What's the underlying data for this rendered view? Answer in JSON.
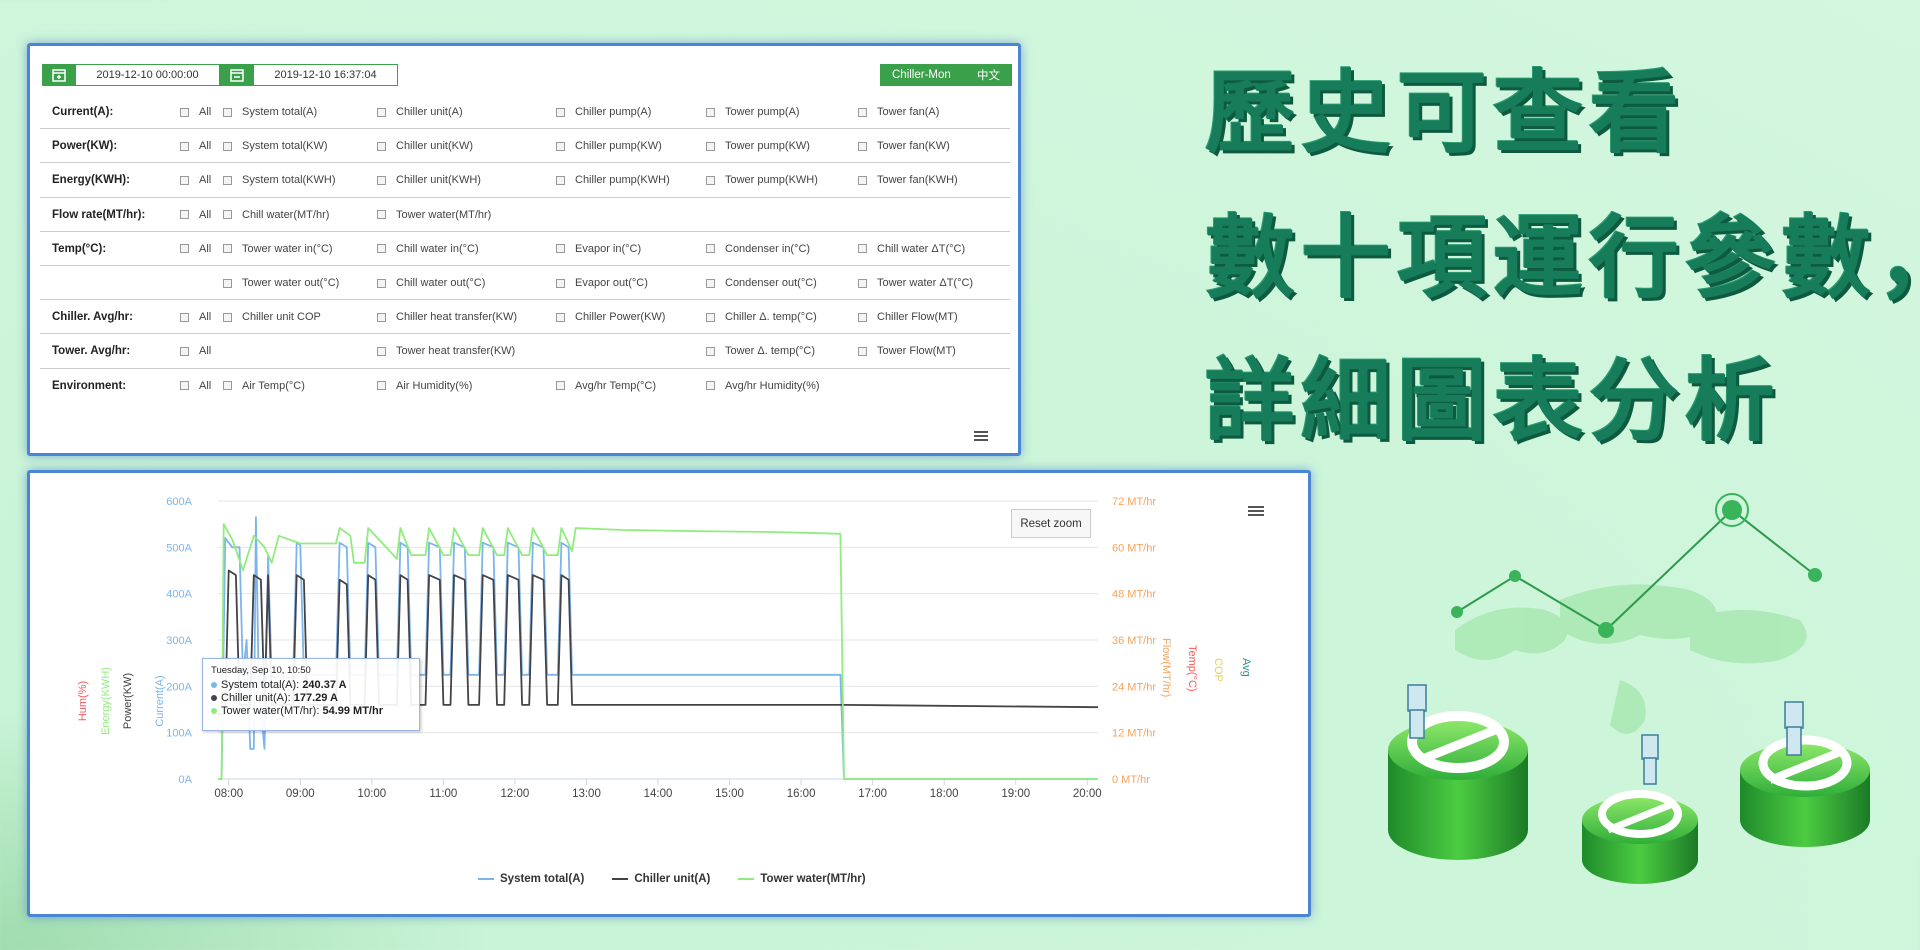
{
  "headline": {
    "line1": "歷史可查看",
    "line2": "數十項運行參數，",
    "line3": "詳細圖表分析"
  },
  "filters": {
    "start_date": "2019-12-10 00:00:00",
    "end_date": "2019-12-10 16:37:04",
    "app_name": "Chiller-Mon",
    "language": "中文",
    "rows": [
      {
        "label": "Current(A):",
        "options": [
          "All",
          "System total(A)",
          "Chiller unit(A)",
          "Chiller pump(A)",
          "Tower pump(A)",
          "Tower fan(A)"
        ]
      },
      {
        "label": "Power(KW):",
        "options": [
          "All",
          "System total(KW)",
          "Chiller unit(KW)",
          "Chiller pump(KW)",
          "Tower pump(KW)",
          "Tower fan(KW)"
        ]
      },
      {
        "label": "Energy(KWH):",
        "options": [
          "All",
          "System total(KWH)",
          "Chiller unit(KWH)",
          "Chiller pump(KWH)",
          "Tower pump(KWH)",
          "Tower fan(KWH)"
        ]
      },
      {
        "label": "Flow rate(MT/hr):",
        "options": [
          "All",
          "Chill water(MT/hr)",
          "Tower water(MT/hr)",
          "",
          "",
          ""
        ]
      },
      {
        "label": "Temp(°C):",
        "options": [
          "All",
          "Tower water in(°C)",
          "Chill water in(°C)",
          "Evapor in(°C)",
          "Condenser in(°C)",
          "Chill water ΔT(°C)"
        ]
      },
      {
        "label": "",
        "options": [
          "",
          "Tower water out(°C)",
          "Chill water out(°C)",
          "Evapor out(°C)",
          "Condenser out(°C)",
          "Tower water ΔT(°C)"
        ]
      },
      {
        "label": "Chiller. Avg/hr:",
        "options": [
          "All",
          "Chiller unit COP",
          "Chiller heat transfer(KW)",
          "Chiller Power(KW)",
          "Chiller Δ. temp(°C)",
          "Chiller Flow(MT)"
        ]
      },
      {
        "label": "Tower. Avg/hr:",
        "options": [
          "All",
          "",
          "Tower heat transfer(KW)",
          "",
          "Tower Δ. temp(°C)",
          "Tower Flow(MT)"
        ]
      },
      {
        "label": "Environment:",
        "options": [
          "All",
          "Air Temp(°C)",
          "Air Humidity(%)",
          "Avg/hr Temp(°C)",
          "Avg/hr Humidity(%)",
          ""
        ]
      }
    ]
  },
  "chart": {
    "reset_zoom_label": "Reset zoom",
    "left_axis_titles": [
      "Hum(%)",
      "Energy(KWH)",
      "Power(KW)",
      "Current(A)"
    ],
    "right_axis_titles": [
      "Flow(MT/hr)",
      "Temp(°C)",
      "COP",
      "Avg"
    ],
    "tooltip": {
      "header": "Tuesday, Sep 10, 10:50",
      "lines": [
        {
          "name": "System total(A):",
          "value": "240.37 A",
          "color": "#7cb5ec"
        },
        {
          "name": "Chiller unit(A):",
          "value": "177.29 A",
          "color": "#434348"
        },
        {
          "name": "Tower water(MT/hr):",
          "value": "54.99 MT/hr",
          "color": "#90ed7d"
        }
      ]
    }
  },
  "chart_data": {
    "type": "line",
    "x_ticks": [
      "08:00",
      "09:00",
      "10:00",
      "11:00",
      "12:00",
      "13:00",
      "14:00",
      "15:00",
      "16:00",
      "17:00",
      "18:00",
      "19:00",
      "20:00"
    ],
    "y_left_ticks": [
      "0A",
      "100A",
      "200A",
      "300A",
      "400A",
      "500A",
      "600A"
    ],
    "y_right_ticks": [
      "0 MT/hr",
      "12 MT/hr",
      "24 MT/hr",
      "36 MT/hr",
      "48 MT/hr",
      "60 MT/hr",
      "72 MT/hr"
    ],
    "ylim_left": [
      0,
      600
    ],
    "ylim_right": [
      0,
      72
    ],
    "xlim_hours": [
      7.85,
      20.15
    ],
    "series": [
      {
        "name": "System total(A)",
        "color": "#7cb5ec",
        "axis": "left",
        "points": [
          [
            7.85,
            0
          ],
          [
            7.9,
            0
          ],
          [
            7.95,
            520
          ],
          [
            8.05,
            500
          ],
          [
            8.15,
            500
          ],
          [
            8.2,
            220
          ],
          [
            8.25,
            300
          ],
          [
            8.3,
            65
          ],
          [
            8.35,
            65
          ],
          [
            8.38,
            565
          ],
          [
            8.42,
            200
          ],
          [
            8.5,
            65
          ],
          [
            8.55,
            480
          ],
          [
            8.6,
            220
          ],
          [
            8.9,
            220
          ],
          [
            8.95,
            510
          ],
          [
            9.0,
            505
          ],
          [
            9.05,
            225
          ],
          [
            9.5,
            225
          ],
          [
            9.55,
            510
          ],
          [
            9.65,
            500
          ],
          [
            9.7,
            225
          ],
          [
            9.9,
            225
          ],
          [
            9.95,
            510
          ],
          [
            10.05,
            500
          ],
          [
            10.1,
            225
          ],
          [
            10.35,
            225
          ],
          [
            10.4,
            510
          ],
          [
            10.5,
            500
          ],
          [
            10.55,
            225
          ],
          [
            10.75,
            225
          ],
          [
            10.8,
            510
          ],
          [
            10.95,
            500
          ],
          [
            11.0,
            225
          ],
          [
            11.1,
            225
          ],
          [
            11.15,
            510
          ],
          [
            11.3,
            500
          ],
          [
            11.35,
            225
          ],
          [
            11.5,
            225
          ],
          [
            11.55,
            510
          ],
          [
            11.7,
            500
          ],
          [
            11.75,
            225
          ],
          [
            11.85,
            225
          ],
          [
            11.9,
            510
          ],
          [
            12.05,
            500
          ],
          [
            12.1,
            225
          ],
          [
            12.2,
            225
          ],
          [
            12.25,
            510
          ],
          [
            12.4,
            500
          ],
          [
            12.45,
            225
          ],
          [
            12.6,
            225
          ],
          [
            12.65,
            510
          ],
          [
            12.75,
            500
          ],
          [
            12.8,
            225
          ],
          [
            16.55,
            225
          ],
          [
            16.6,
            0
          ],
          [
            20.15,
            0
          ]
        ]
      },
      {
        "name": "Chiller unit(A)",
        "color": "#434348",
        "axis": "left",
        "points": [
          [
            7.85,
            140
          ],
          [
            7.95,
            140
          ],
          [
            8.0,
            450
          ],
          [
            8.1,
            440
          ],
          [
            8.15,
            160
          ],
          [
            8.3,
            160
          ],
          [
            8.35,
            440
          ],
          [
            8.45,
            430
          ],
          [
            8.5,
            160
          ],
          [
            8.55,
            440
          ],
          [
            8.6,
            160
          ],
          [
            8.9,
            160
          ],
          [
            8.95,
            440
          ],
          [
            9.05,
            430
          ],
          [
            9.1,
            160
          ],
          [
            9.5,
            160
          ],
          [
            9.55,
            430
          ],
          [
            9.65,
            420
          ],
          [
            9.7,
            160
          ],
          [
            9.9,
            160
          ],
          [
            9.95,
            440
          ],
          [
            10.05,
            430
          ],
          [
            10.1,
            160
          ],
          [
            10.35,
            160
          ],
          [
            10.4,
            440
          ],
          [
            10.5,
            430
          ],
          [
            10.55,
            160
          ],
          [
            10.75,
            160
          ],
          [
            10.8,
            440
          ],
          [
            10.95,
            430
          ],
          [
            11.0,
            160
          ],
          [
            11.1,
            160
          ],
          [
            11.15,
            440
          ],
          [
            11.3,
            430
          ],
          [
            11.35,
            160
          ],
          [
            11.5,
            160
          ],
          [
            11.55,
            440
          ],
          [
            11.7,
            430
          ],
          [
            11.75,
            160
          ],
          [
            11.85,
            160
          ],
          [
            11.9,
            440
          ],
          [
            12.05,
            430
          ],
          [
            12.1,
            160
          ],
          [
            12.2,
            160
          ],
          [
            12.25,
            440
          ],
          [
            12.4,
            430
          ],
          [
            12.45,
            160
          ],
          [
            12.6,
            160
          ],
          [
            12.65,
            440
          ],
          [
            12.75,
            430
          ],
          [
            12.8,
            160
          ],
          [
            16.6,
            160
          ],
          [
            20.15,
            155
          ]
        ]
      },
      {
        "name": "Tower water(MT/hr)",
        "color": "#90ed7d",
        "axis": "right",
        "points": [
          [
            7.85,
            0
          ],
          [
            7.9,
            0
          ],
          [
            7.93,
            66
          ],
          [
            8.05,
            62
          ],
          [
            8.2,
            54
          ],
          [
            8.35,
            63
          ],
          [
            8.5,
            60
          ],
          [
            8.6,
            56
          ],
          [
            8.7,
            63
          ],
          [
            9.0,
            61
          ],
          [
            9.5,
            61
          ],
          [
            9.55,
            65
          ],
          [
            9.7,
            63
          ],
          [
            9.75,
            56
          ],
          [
            9.9,
            56
          ],
          [
            9.95,
            65
          ],
          [
            10.1,
            62
          ],
          [
            10.35,
            57
          ],
          [
            10.4,
            65
          ],
          [
            10.55,
            58
          ],
          [
            10.75,
            58
          ],
          [
            10.8,
            65
          ],
          [
            11.0,
            58
          ],
          [
            11.1,
            58
          ],
          [
            11.15,
            65
          ],
          [
            11.35,
            58
          ],
          [
            11.5,
            58
          ],
          [
            11.55,
            65
          ],
          [
            11.75,
            58
          ],
          [
            11.85,
            58
          ],
          [
            11.9,
            65
          ],
          [
            12.1,
            58
          ],
          [
            12.2,
            58
          ],
          [
            12.25,
            65
          ],
          [
            12.45,
            58
          ],
          [
            12.6,
            58
          ],
          [
            12.65,
            65
          ],
          [
            12.8,
            59
          ],
          [
            12.85,
            65
          ],
          [
            13.5,
            64.5
          ],
          [
            14.5,
            64.2
          ],
          [
            15.5,
            64
          ],
          [
            16.0,
            63.8
          ],
          [
            16.55,
            63.5
          ],
          [
            16.6,
            0
          ],
          [
            20.15,
            0
          ]
        ]
      }
    ]
  }
}
